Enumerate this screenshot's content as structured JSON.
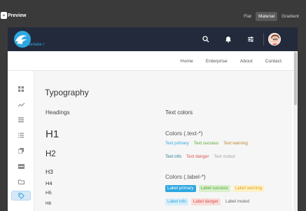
{
  "preview": {
    "back_icon": "chevron-left-double-icon",
    "back_glyph": "«",
    "label": "Preview",
    "style_tabs": [
      {
        "label": "Flat",
        "active": false
      },
      {
        "label": "Material",
        "active": true
      },
      {
        "label": "Gradient",
        "active": false
      }
    ]
  },
  "header": {
    "logo_text": "waterlake r",
    "icons": [
      "search-icon",
      "bell-icon",
      "sliders-icon"
    ],
    "avatar": "user-avatar"
  },
  "nav": {
    "items": [
      "Home",
      "Enterprise",
      "About",
      "Contact"
    ]
  },
  "sidebar": {
    "items": [
      {
        "icon": "dashboard-icon",
        "active": false
      },
      {
        "icon": "chart-line-icon",
        "active": false
      },
      {
        "icon": "list-icon",
        "active": false
      },
      {
        "icon": "list-bulleted-icon",
        "active": false
      },
      {
        "icon": "copy-icon",
        "active": false
      },
      {
        "icon": "card-icon",
        "active": false
      },
      {
        "icon": "folder-icon",
        "active": false
      },
      {
        "icon": "tag-icon",
        "active": true
      }
    ]
  },
  "main": {
    "title": "Typography",
    "headings": {
      "title": "Headings",
      "items": [
        "H1",
        "H2",
        "H3",
        "H4",
        "H5",
        "H6"
      ]
    },
    "text_colors": {
      "title": "Text colors",
      "text_section": "Colors (.text-*)",
      "text_items": [
        {
          "label": "Text primary",
          "color": "#2ea7e0"
        },
        {
          "label": "Text success",
          "color": "#5aa832"
        },
        {
          "label": "Text warning",
          "color": "#b8862e"
        },
        {
          "label": "Text info",
          "color": "#2a7d8f"
        },
        {
          "label": "Text danger",
          "color": "#d9534f"
        },
        {
          "label": "Text muted",
          "color": "#a6a6a6"
        }
      ],
      "label_section": "Colors (.label-*)",
      "label_items": [
        {
          "label": "Label primary",
          "bg": "#2ea7e0",
          "color": "#ffffff"
        },
        {
          "label": "Label success",
          "bg": "#d9f0cd",
          "color": "#5aa832"
        },
        {
          "label": "Label warning",
          "bg": "#fdf1c9",
          "color": "#e8a21a"
        },
        {
          "label": "Label info",
          "bg": "#d6eefb",
          "color": "#2ea7e0"
        },
        {
          "label": "Label danger",
          "bg": "#fbdcd8",
          "color": "#d9534f"
        },
        {
          "label": "Label muted",
          "bg": "#f6f6f6",
          "color": "#666666"
        }
      ]
    }
  }
}
